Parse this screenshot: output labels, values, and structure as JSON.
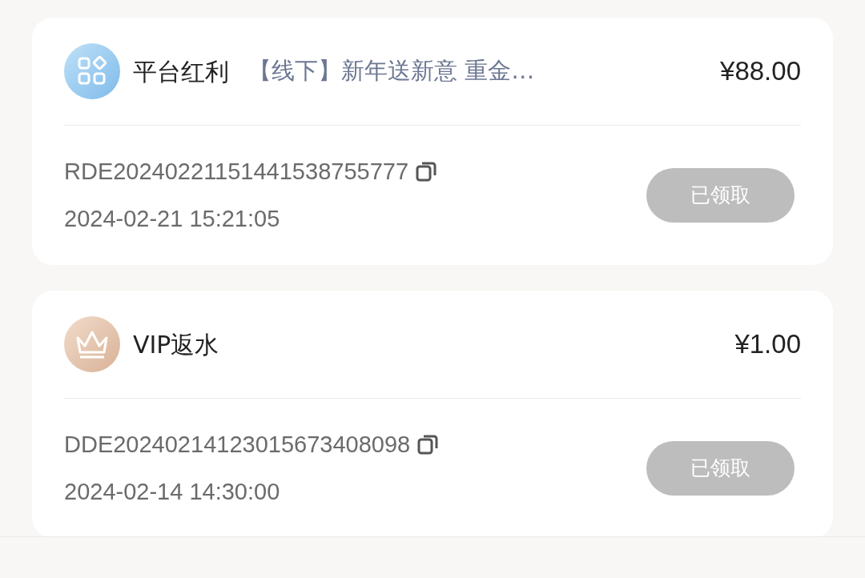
{
  "records": [
    {
      "kind": "grid",
      "category": "平台红利",
      "title": "【线下】新年送新意 重金…",
      "amount": "¥88.00",
      "order_no": "RDE20240221151441538755777",
      "time": "2024-02-21 15:21:05",
      "button": {
        "label": "已领取",
        "disabled": true
      }
    },
    {
      "kind": "crown",
      "category": "VIP返水",
      "amount": "¥1.00",
      "order_no": "DDE20240214123015673408098",
      "time": "2024-02-14 14:30:00",
      "button": {
        "label": "已领取",
        "disabled": true
      }
    }
  ]
}
